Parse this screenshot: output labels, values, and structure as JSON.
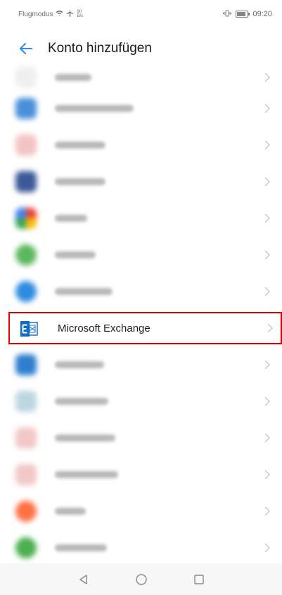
{
  "status_bar": {
    "carrier": "Flugmodus",
    "speed_value": "90",
    "speed_unit": "B/s",
    "time": "09:20"
  },
  "header": {
    "title": "Konto hinzufügen",
    "back_icon": "arrow-left-icon"
  },
  "colors": {
    "accent": "#2f8ae0",
    "highlight_border": "#e10000",
    "exchange_blue": "#0f6cc0"
  },
  "account_list": {
    "highlighted_item": {
      "label": "Microsoft Exchange",
      "icon": "microsoft-exchange-icon"
    },
    "blurred_item_icon_colors": [
      "#e8e8e8",
      "#4a90d9",
      "#e06b6b",
      "#3b5998",
      "#f2b134",
      "#5cb85c",
      "#2f8ae0",
      "#2f7fd0",
      "#a9c8d6",
      "#e07a7a",
      "#e07a7a",
      "#ff7043",
      "#4caf50"
    ]
  },
  "nav_bar": {
    "back_icon": "nav-back-triangle-icon",
    "home_icon": "nav-home-circle-icon",
    "recents_icon": "nav-recents-square-icon"
  }
}
